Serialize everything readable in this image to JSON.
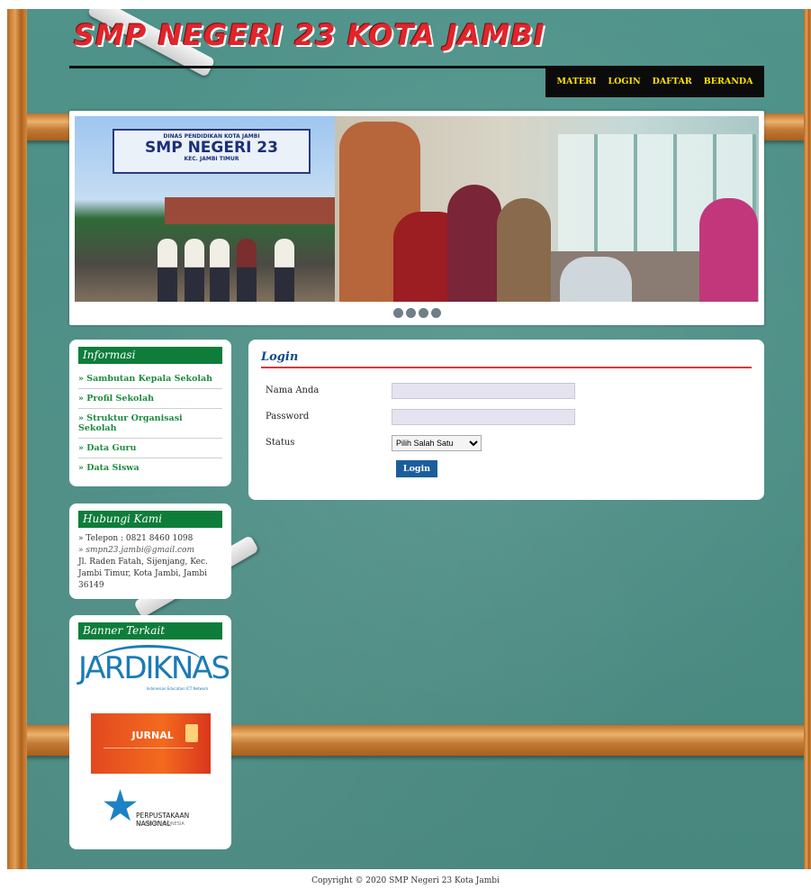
{
  "site": {
    "title": "SMP NEGERI 23 KOTA JAMBI"
  },
  "nav": {
    "items": [
      "MATERI",
      "LOGIN",
      "DAFTAR",
      "BERANDA"
    ],
    "color": "#ffe400"
  },
  "slider": {
    "sign_line1": "DINAS PENDIDIKAN KOTA JAMBI",
    "sign_line2": "SMP NEGERI 23",
    "sign_line3": "KEC. JAMBI TIMUR",
    "dots": 4
  },
  "sidebar": {
    "info": {
      "title": "Informasi",
      "items": [
        "» Sambutan Kepala Sekolah",
        "» Profil Sekolah",
        "» Struktur Organisasi Sekolah",
        "» Data Guru",
        "» Data Siswa"
      ]
    },
    "contact": {
      "title": "Hubungi Kami",
      "phone": "» Telepon : 0821 8460 1098",
      "email": "» smpn23.jambi@gmail.com",
      "address": "Jl. Raden Fatah, Sijenjang, Kec. Jambi Timur, Kota Jambi, Jambi 36149"
    },
    "banner": {
      "title": "Banner Terkait",
      "jardiknas": "JARDIKNAS",
      "jardiknas_sub": "Indonesian Education ICT Network",
      "jurnal": "JURNAL",
      "perpus": "PERPUSTAKAAN NASIONAL",
      "perpus_sub": "REPUBLIK INDONESIA"
    }
  },
  "login": {
    "title": "Login",
    "name_label": "Nama Anda",
    "password_label": "Password",
    "status_label": "Status",
    "status_selected": "Pilih Salah Satu",
    "button": "Login"
  },
  "footer": {
    "text": "Copyright © 2020 SMP Negeri 23 Kota Jambi"
  },
  "colors": {
    "board": "#4a8f85",
    "title": "#e1252b",
    "sidebar_header": "#0e7d3a",
    "login_button": "#1b5e9c"
  }
}
